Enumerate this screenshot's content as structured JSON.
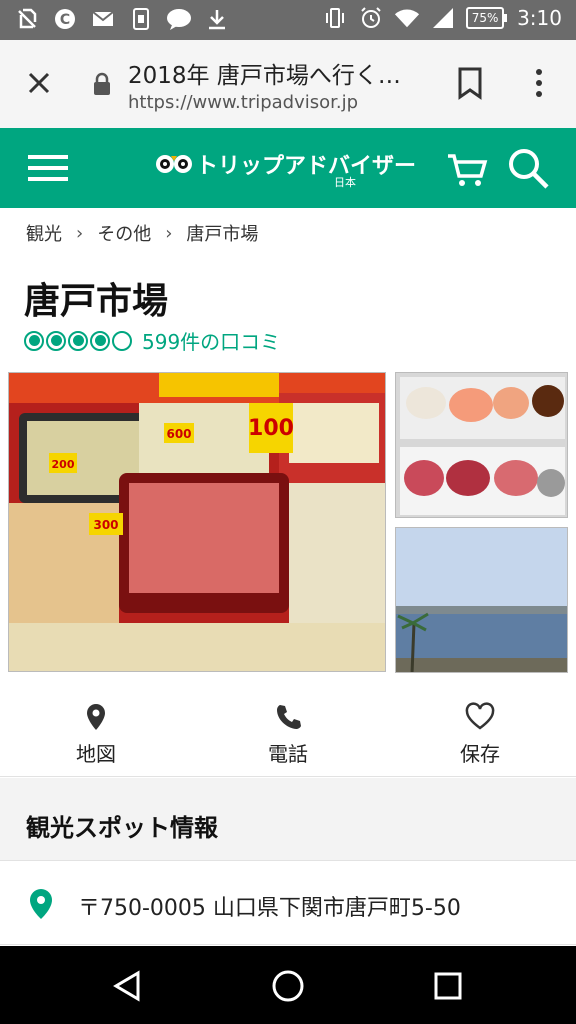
{
  "status_bar": {
    "battery": "75%",
    "time": "3:10",
    "icons": [
      "no-sim-icon",
      "c-app-icon",
      "mail-icon",
      "phone-frame-icon",
      "chat-bubble-icon",
      "download-icon",
      "vibrate-icon",
      "alarm-icon",
      "wifi-icon",
      "signal-icon"
    ]
  },
  "browser": {
    "title": "2018年 唐戸市場へ行く…",
    "url": "https://www.tripadvisor.jp"
  },
  "site_header": {
    "brand_name": "トリップアドバイザー",
    "country": "日本",
    "brand_color": "#00a680"
  },
  "breadcrumb": [
    "観光",
    "その他",
    "唐戸市場"
  ],
  "page": {
    "title": "唐戸市場",
    "rating_bubbles": 4,
    "reviews_label": "599件の口コミ"
  },
  "gallery": {
    "main_sign_texts": [
      "600",
      "100",
      "300",
      "200"
    ]
  },
  "actions": [
    {
      "label": "地図",
      "icon": "map-pin-icon"
    },
    {
      "label": "電話",
      "icon": "phone-icon"
    },
    {
      "label": "保存",
      "icon": "heart-icon"
    }
  ],
  "info_section": {
    "heading": "観光スポット情報",
    "address": "〒750-0005 山口県下関市唐戸町5-50"
  }
}
